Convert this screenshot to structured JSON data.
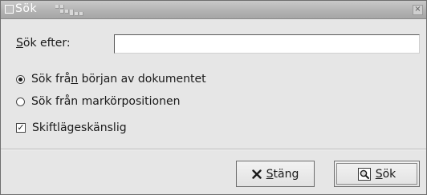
{
  "window": {
    "title": "Sök",
    "close_glyph": "×"
  },
  "form": {
    "search_label_mnemonic": "S",
    "search_label_rest": "ök efter:",
    "search_value": "",
    "search_placeholder": ""
  },
  "options": {
    "radio_from_start_pre": "Sök frå",
    "radio_from_start_mnemonic": "n",
    "radio_from_start_post": " början av dokumentet",
    "radio_from_start_checked": true,
    "radio_from_cursor_label": "Sök från markörpositionen",
    "radio_from_cursor_checked": false,
    "case_sensitive_label": "Skiftlägeskänslig",
    "case_sensitive_checked": true,
    "check_glyph": "✓"
  },
  "buttons": {
    "close_mnemonic": "S",
    "close_rest": "täng",
    "close_icon": "close-x-icon",
    "search_mnemonic": "S",
    "search_rest": "ök",
    "search_icon": "find-magnifier-icon"
  }
}
